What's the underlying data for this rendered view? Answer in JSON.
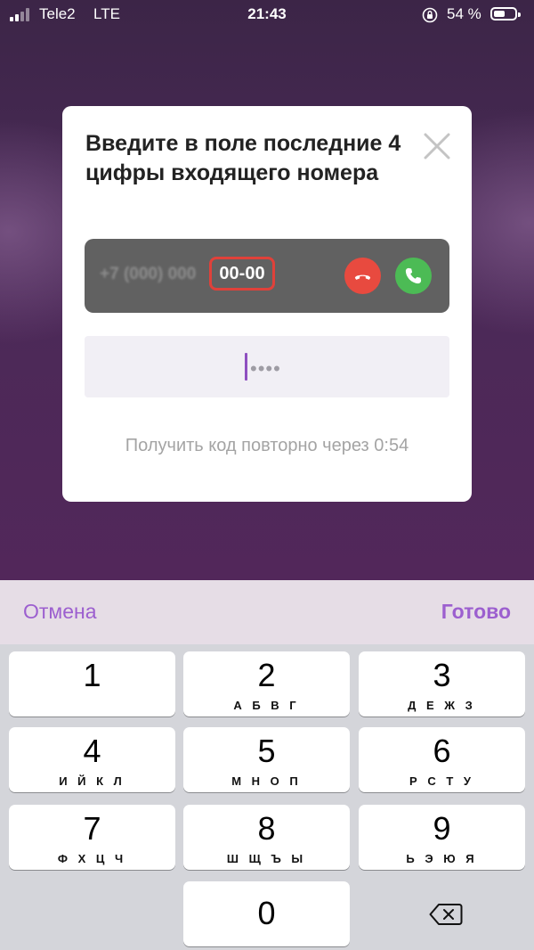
{
  "status_bar": {
    "carrier": "Tele2",
    "network": "LTE",
    "time": "21:43",
    "battery_percent": "54 %",
    "battery_level": 0.54,
    "icons": [
      "signal-icon",
      "rotation-lock-icon",
      "battery-icon"
    ]
  },
  "modal": {
    "title": "Введите в поле последние 4 цифры входящего номера",
    "preview": {
      "number_prefix": "+7 (000) 000",
      "highlighted_digits": "00-00"
    },
    "code_placeholder": "••••",
    "resend_text": "Получить код повторно через 0:54"
  },
  "toolbar": {
    "cancel_label": "Отмена",
    "done_label": "Готово",
    "accent_color": "#9c5fcf"
  },
  "keypad": {
    "keys": [
      {
        "digit": "1",
        "letters": ""
      },
      {
        "digit": "2",
        "letters": "А Б В Г"
      },
      {
        "digit": "3",
        "letters": "Д Е Ж З"
      },
      {
        "digit": "4",
        "letters": "И Й К Л"
      },
      {
        "digit": "5",
        "letters": "М Н О П"
      },
      {
        "digit": "6",
        "letters": "Р С Т У"
      },
      {
        "digit": "7",
        "letters": "Ф Х Ц Ч"
      },
      {
        "digit": "8",
        "letters": "Ш Щ Ъ Ы"
      },
      {
        "digit": "9",
        "letters": "Ь Э Ю Я"
      },
      {
        "digit": "0",
        "letters": ""
      }
    ]
  }
}
